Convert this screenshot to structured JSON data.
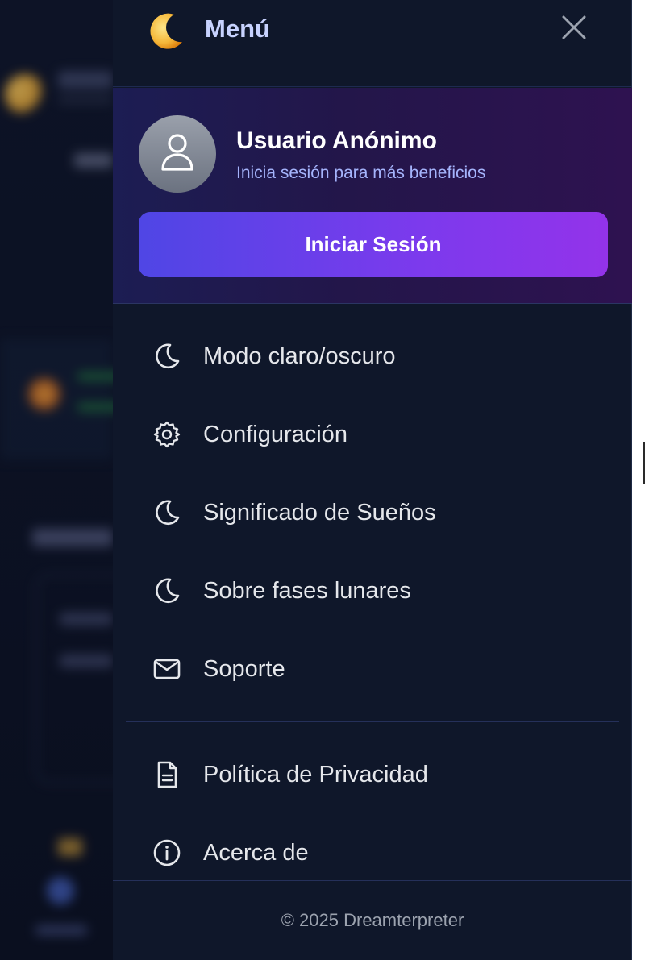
{
  "header": {
    "title": "Menú",
    "logo_icon": "crescent-moon-icon",
    "close_icon": "close-icon"
  },
  "profile": {
    "name": "Usuario Anónimo",
    "subtitle": "Inicia sesión para más beneficios",
    "login_label": "Iniciar Sesión",
    "avatar_icon": "user-icon"
  },
  "menu": {
    "items": [
      {
        "label": "Modo claro/oscuro",
        "icon": "moon-icon"
      },
      {
        "label": "Configuración",
        "icon": "gear-icon"
      },
      {
        "label": "Significado de Sueños",
        "icon": "moon-icon"
      },
      {
        "label": "Sobre fases lunares",
        "icon": "moon-icon"
      },
      {
        "label": "Soporte",
        "icon": "mail-icon"
      }
    ],
    "secondary_items": [
      {
        "label": "Política de Privacidad",
        "icon": "document-icon"
      },
      {
        "label": "Acerca de",
        "icon": "info-icon"
      }
    ]
  },
  "footer": {
    "copyright": "© 2025 Dreamterpreter"
  },
  "colors": {
    "drawer_bg": "#0f172a",
    "accent_start": "#4f46e5",
    "accent_end": "#9333ea",
    "title": "#c7d2fe",
    "subtitle": "#a5b4fc"
  }
}
